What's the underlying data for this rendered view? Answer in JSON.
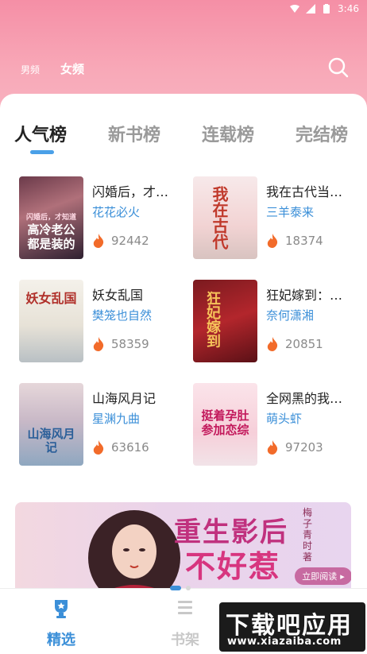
{
  "status_bar": {
    "time": "3:46"
  },
  "header": {
    "gender_tabs": [
      "男频",
      "女频"
    ]
  },
  "rank_tabs": [
    "人气榜",
    "新书榜",
    "连载榜",
    "完结榜"
  ],
  "books": [
    {
      "title": "闪婚后，才…",
      "author": "花花必火",
      "heat": "92442",
      "cover_text": "高冷老公都是装的",
      "cover_sub": "闪婚后，才知道"
    },
    {
      "title": "我在古代当…",
      "author": "三羊泰来",
      "heat": "18374",
      "cover_text": "我在古代",
      "cover_sub": ""
    },
    {
      "title": "妖女乱国",
      "author": "樊笼也自然",
      "heat": "58359",
      "cover_text": "妖女乱国",
      "cover_sub": ""
    },
    {
      "title": "狂妃嫁到：…",
      "author": "奈何潇湘",
      "heat": "20851",
      "cover_text": "狂妃嫁到",
      "cover_sub": ""
    },
    {
      "title": "山海风月记",
      "author": "星渊九曲",
      "heat": "63616",
      "cover_text": "山海风月记",
      "cover_sub": ""
    },
    {
      "title": "全网黑的我…",
      "author": "萌头虾",
      "heat": "97203",
      "cover_text": "挺着孕肚参加恋综",
      "cover_sub": ""
    }
  ],
  "banner": {
    "title_line1": "重生影后",
    "title_line2": "不好惹",
    "author": "梅子青时著",
    "button": "立即阅读"
  },
  "bottom_nav": [
    {
      "label": "精选",
      "active": true
    },
    {
      "label": "书架",
      "active": false
    }
  ],
  "watermark": {
    "title": "下载吧应用",
    "url": "www.xiazaiba.com"
  },
  "colors": {
    "accent": "#3b8fd8",
    "header_pink": "#f58fa6",
    "fire": "#f26b2a"
  }
}
